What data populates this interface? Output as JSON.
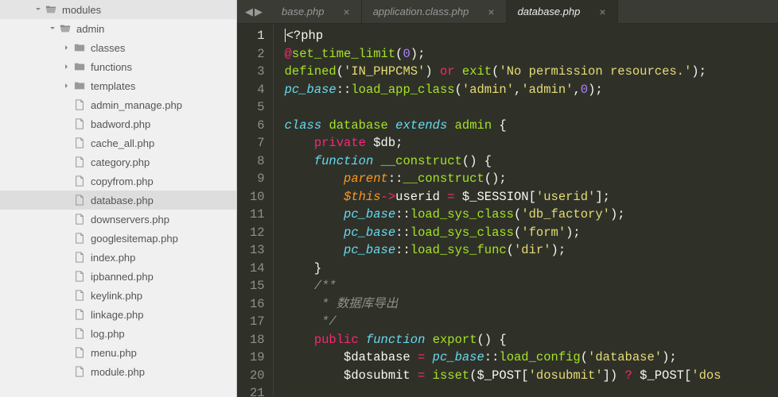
{
  "sidebar": {
    "tree": [
      {
        "label": "modules",
        "type": "folder-open",
        "indent": 42,
        "arrow": "down"
      },
      {
        "label": "admin",
        "type": "folder-open",
        "indent": 60,
        "arrow": "down"
      },
      {
        "label": "classes",
        "type": "folder",
        "indent": 78,
        "arrow": "right"
      },
      {
        "label": "functions",
        "type": "folder",
        "indent": 78,
        "arrow": "right"
      },
      {
        "label": "templates",
        "type": "folder",
        "indent": 78,
        "arrow": "right"
      },
      {
        "label": "admin_manage.php",
        "type": "file",
        "indent": 78
      },
      {
        "label": "badword.php",
        "type": "file",
        "indent": 78
      },
      {
        "label": "cache_all.php",
        "type": "file",
        "indent": 78
      },
      {
        "label": "category.php",
        "type": "file",
        "indent": 78
      },
      {
        "label": "copyfrom.php",
        "type": "file",
        "indent": 78
      },
      {
        "label": "database.php",
        "type": "file",
        "indent": 78,
        "selected": true
      },
      {
        "label": "downservers.php",
        "type": "file",
        "indent": 78
      },
      {
        "label": "googlesitemap.php",
        "type": "file",
        "indent": 78
      },
      {
        "label": "index.php",
        "type": "file",
        "indent": 78
      },
      {
        "label": "ipbanned.php",
        "type": "file",
        "indent": 78
      },
      {
        "label": "keylink.php",
        "type": "file",
        "indent": 78
      },
      {
        "label": "linkage.php",
        "type": "file",
        "indent": 78
      },
      {
        "label": "log.php",
        "type": "file",
        "indent": 78
      },
      {
        "label": "menu.php",
        "type": "file",
        "indent": 78
      },
      {
        "label": "module.php",
        "type": "file",
        "indent": 78
      }
    ]
  },
  "tabs": [
    {
      "label": "base.php",
      "active": false
    },
    {
      "label": "application.class.php",
      "active": false
    },
    {
      "label": "database.php",
      "active": true
    }
  ],
  "close_glyph": "×",
  "nav": {
    "back": "◀",
    "forward": "▶"
  },
  "gutter": {
    "start": 1,
    "end": 21,
    "active": 1
  },
  "code": {
    "lines": [
      [
        {
          "t": "<",
          "c": "pn",
          "cursor": true
        },
        {
          "t": "?php",
          "c": "pn"
        }
      ],
      [
        {
          "t": "@",
          "c": "kw"
        },
        {
          "t": "set_time_limit",
          "c": "fn"
        },
        {
          "t": "(",
          "c": "pn"
        },
        {
          "t": "0",
          "c": "num"
        },
        {
          "t": ");",
          "c": "pn"
        }
      ],
      [
        {
          "t": "defined",
          "c": "fn"
        },
        {
          "t": "(",
          "c": "pn"
        },
        {
          "t": "'IN_PHPCMS'",
          "c": "str"
        },
        {
          "t": ") ",
          "c": "pn"
        },
        {
          "t": "or",
          "c": "kw"
        },
        {
          "t": " ",
          "c": "pn"
        },
        {
          "t": "exit",
          "c": "fn"
        },
        {
          "t": "(",
          "c": "pn"
        },
        {
          "t": "'No permission resources.'",
          "c": "str"
        },
        {
          "t": ");",
          "c": "pn"
        }
      ],
      [
        {
          "t": "pc_base",
          "c": "type"
        },
        {
          "t": "::",
          "c": "pn"
        },
        {
          "t": "load_app_class",
          "c": "fn"
        },
        {
          "t": "(",
          "c": "pn"
        },
        {
          "t": "'admin'",
          "c": "str"
        },
        {
          "t": ",",
          "c": "pn"
        },
        {
          "t": "'admin'",
          "c": "str"
        },
        {
          "t": ",",
          "c": "pn"
        },
        {
          "t": "0",
          "c": "num"
        },
        {
          "t": ");",
          "c": "pn"
        }
      ],
      [],
      [
        {
          "t": "class",
          "c": "kw2"
        },
        {
          "t": " ",
          "c": "pn"
        },
        {
          "t": "database",
          "c": "cls"
        },
        {
          "t": " ",
          "c": "pn"
        },
        {
          "t": "extends",
          "c": "kw2"
        },
        {
          "t": " ",
          "c": "pn"
        },
        {
          "t": "admin",
          "c": "cls"
        },
        {
          "t": " {",
          "c": "pn"
        }
      ],
      [
        {
          "t": "    ",
          "c": "pn"
        },
        {
          "t": "private",
          "c": "kw"
        },
        {
          "t": " $db;",
          "c": "pn"
        }
      ],
      [
        {
          "t": "    ",
          "c": "pn"
        },
        {
          "t": "function",
          "c": "kw2"
        },
        {
          "t": " ",
          "c": "pn"
        },
        {
          "t": "__construct",
          "c": "fn"
        },
        {
          "t": "() {",
          "c": "pn"
        }
      ],
      [
        {
          "t": "        ",
          "c": "pn"
        },
        {
          "t": "parent",
          "c": "var"
        },
        {
          "t": "::",
          "c": "pn"
        },
        {
          "t": "__construct",
          "c": "fn"
        },
        {
          "t": "();",
          "c": "pn"
        }
      ],
      [
        {
          "t": "        ",
          "c": "pn"
        },
        {
          "t": "$this",
          "c": "var"
        },
        {
          "t": "->",
          "c": "op"
        },
        {
          "t": "userid ",
          "c": "pn"
        },
        {
          "t": "=",
          "c": "op"
        },
        {
          "t": " $_SESSION[",
          "c": "pn"
        },
        {
          "t": "'userid'",
          "c": "str"
        },
        {
          "t": "];",
          "c": "pn"
        }
      ],
      [
        {
          "t": "        ",
          "c": "pn"
        },
        {
          "t": "pc_base",
          "c": "type"
        },
        {
          "t": "::",
          "c": "pn"
        },
        {
          "t": "load_sys_class",
          "c": "fn"
        },
        {
          "t": "(",
          "c": "pn"
        },
        {
          "t": "'db_factory'",
          "c": "str"
        },
        {
          "t": ");",
          "c": "pn"
        }
      ],
      [
        {
          "t": "        ",
          "c": "pn"
        },
        {
          "t": "pc_base",
          "c": "type"
        },
        {
          "t": "::",
          "c": "pn"
        },
        {
          "t": "load_sys_class",
          "c": "fn"
        },
        {
          "t": "(",
          "c": "pn"
        },
        {
          "t": "'form'",
          "c": "str"
        },
        {
          "t": ");",
          "c": "pn"
        }
      ],
      [
        {
          "t": "        ",
          "c": "pn"
        },
        {
          "t": "pc_base",
          "c": "type"
        },
        {
          "t": "::",
          "c": "pn"
        },
        {
          "t": "load_sys_func",
          "c": "fn"
        },
        {
          "t": "(",
          "c": "pn"
        },
        {
          "t": "'dir'",
          "c": "str"
        },
        {
          "t": ");",
          "c": "pn"
        }
      ],
      [
        {
          "t": "    }",
          "c": "pn"
        }
      ],
      [
        {
          "t": "    ",
          "c": "pn"
        },
        {
          "t": "/**",
          "c": "cmt"
        }
      ],
      [
        {
          "t": "    ",
          "c": "pn"
        },
        {
          "t": " * 数据库导出",
          "c": "cmt"
        }
      ],
      [
        {
          "t": "    ",
          "c": "pn"
        },
        {
          "t": " */",
          "c": "cmt"
        }
      ],
      [
        {
          "t": "    ",
          "c": "pn"
        },
        {
          "t": "public",
          "c": "kw"
        },
        {
          "t": " ",
          "c": "pn"
        },
        {
          "t": "function",
          "c": "kw2"
        },
        {
          "t": " ",
          "c": "pn"
        },
        {
          "t": "export",
          "c": "fn"
        },
        {
          "t": "() {",
          "c": "pn"
        }
      ],
      [
        {
          "t": "        $database ",
          "c": "pn"
        },
        {
          "t": "=",
          "c": "op"
        },
        {
          "t": " ",
          "c": "pn"
        },
        {
          "t": "pc_base",
          "c": "type"
        },
        {
          "t": "::",
          "c": "pn"
        },
        {
          "t": "load_config",
          "c": "fn"
        },
        {
          "t": "(",
          "c": "pn"
        },
        {
          "t": "'database'",
          "c": "str"
        },
        {
          "t": ");",
          "c": "pn"
        }
      ],
      [
        {
          "t": "        $dosubmit ",
          "c": "pn"
        },
        {
          "t": "=",
          "c": "op"
        },
        {
          "t": " ",
          "c": "pn"
        },
        {
          "t": "isset",
          "c": "fn"
        },
        {
          "t": "($_POST[",
          "c": "pn"
        },
        {
          "t": "'dosubmit'",
          "c": "str"
        },
        {
          "t": "]) ",
          "c": "pn"
        },
        {
          "t": "?",
          "c": "op"
        },
        {
          "t": " $_POST[",
          "c": "pn"
        },
        {
          "t": "'dos",
          "c": "str"
        }
      ]
    ]
  }
}
